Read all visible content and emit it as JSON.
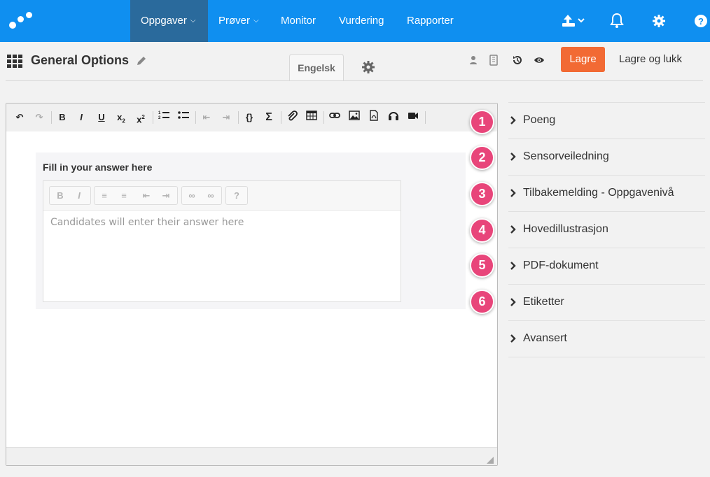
{
  "nav": {
    "items": [
      {
        "label": "Oppgaver",
        "active": true,
        "has_dropdown": true
      },
      {
        "label": "Prøver",
        "active": false,
        "has_dropdown": true
      },
      {
        "label": "Monitor",
        "active": false,
        "has_dropdown": false
      },
      {
        "label": "Vurdering",
        "active": false,
        "has_dropdown": false
      },
      {
        "label": "Rapporter",
        "active": false,
        "has_dropdown": false
      }
    ],
    "right_icons": [
      "upload-icon",
      "bell-icon",
      "gear-icon",
      "help-icon"
    ],
    "colors": {
      "bar": "#0f8ff0",
      "active": "#2a6a9c"
    }
  },
  "header": {
    "title": "General Options",
    "language_tab": "Engelsk",
    "save_label": "Lagre",
    "save_close_label": "Lagre og lukk",
    "save_color": "#f26a34"
  },
  "editor": {
    "toolbar_icons": [
      "undo-icon",
      "redo-icon",
      "bold-icon",
      "italic-icon",
      "underline-icon",
      "subscript-icon",
      "superscript-icon",
      "ordered-list-icon",
      "bullet-list-icon",
      "outdent-icon",
      "indent-icon",
      "braces-icon",
      "sigma-icon",
      "attachment-icon",
      "table-icon",
      "link-icon",
      "image-icon",
      "pdf-icon",
      "audio-icon",
      "video-icon"
    ],
    "question_label": "Fill in your answer here",
    "answer_placeholder": "Candidates will enter their answer here"
  },
  "sidebar": {
    "items": [
      {
        "label": "Poeng",
        "badge": "1"
      },
      {
        "label": "Sensorveiledning",
        "badge": "2"
      },
      {
        "label": "Tilbakemelding - Oppgavenivå",
        "badge": "3"
      },
      {
        "label": "Hovedillustrasjon",
        "badge": "4"
      },
      {
        "label": "PDF-dokument",
        "badge": "5"
      },
      {
        "label": "Etiketter",
        "badge": "6"
      },
      {
        "label": "Avansert",
        "badge": null
      }
    ],
    "badge_color": "#e8457a"
  }
}
